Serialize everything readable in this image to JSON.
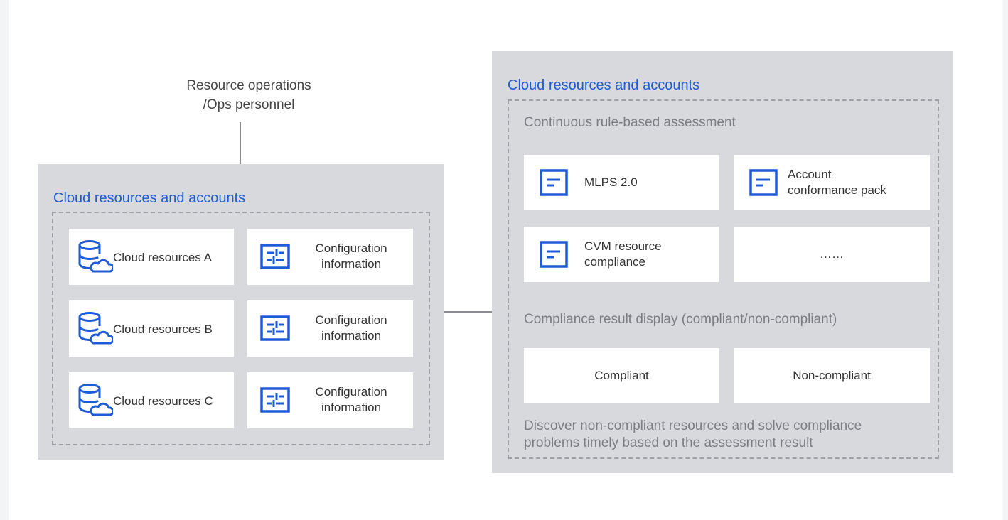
{
  "top_label": {
    "line1": "Resource operations",
    "line2": "/Ops personnel"
  },
  "left_panel": {
    "title": "Cloud resources and accounts",
    "rows": [
      {
        "resource": "Cloud resources A",
        "config_line1": "Configuration",
        "config_line2": "information"
      },
      {
        "resource": "Cloud resources B",
        "config_line1": "Configuration",
        "config_line2": "information"
      },
      {
        "resource": "Cloud resources C",
        "config_line1": "Configuration",
        "config_line2": "information"
      }
    ]
  },
  "right_panel": {
    "title": "Cloud resources and accounts",
    "assessment_label": "Continuous rule-based assessment",
    "rules": [
      {
        "line1": "MLPS 2.0",
        "line2": ""
      },
      {
        "line1": "Account",
        "line2": "conformance pack"
      },
      {
        "line1": "CVM resource",
        "line2": "compliance"
      },
      {
        "line1": "……",
        "line2": ""
      }
    ],
    "result_label": "Compliance result display (compliant/non-compliant)",
    "results": [
      "Compliant",
      "Non-compliant"
    ],
    "footer_line1": "Discover non-compliant resources and solve compliance",
    "footer_line2": "problems timely based on the assessment result"
  },
  "colors": {
    "accent": "#1e5bd6",
    "panel": "#d8d9dd",
    "arrow": "#8a8c92",
    "muted_text": "#7b7d83"
  },
  "icons": {
    "resource_icon": "database-cloud-icon",
    "config_icon": "sliders-config-icon",
    "rule_icon": "rule-document-icon"
  }
}
